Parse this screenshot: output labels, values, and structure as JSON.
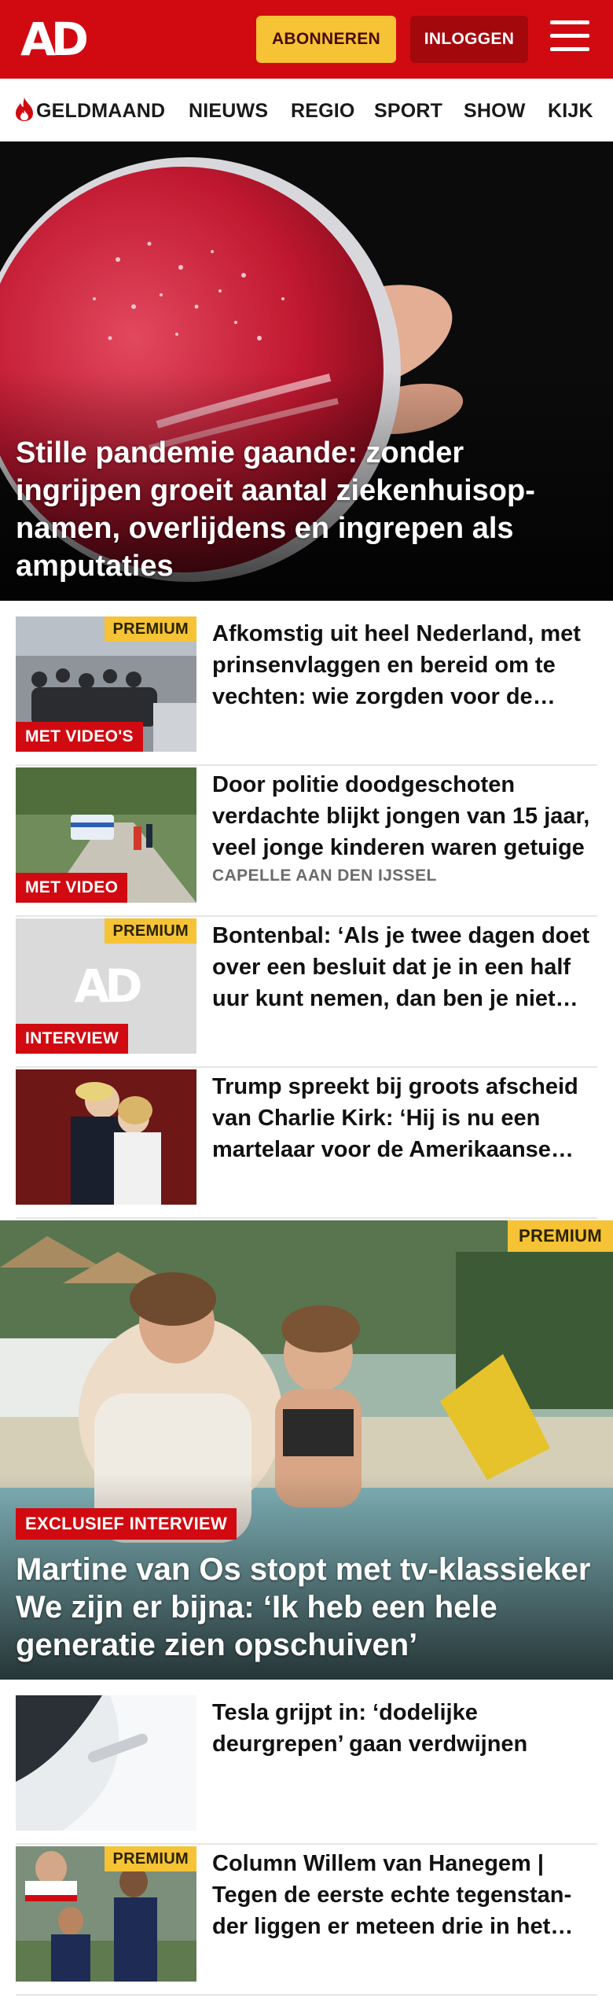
{
  "header": {
    "logo": "AD",
    "subscribe_label": "ABONNEREN",
    "login_label": "INLOGGEN"
  },
  "nav": {
    "items": [
      {
        "label": "GELDMAAND",
        "icon": "flame-icon"
      },
      {
        "label": "NIEUWS"
      },
      {
        "label": "REGIO"
      },
      {
        "label": "SPORT"
      },
      {
        "label": "SHOW"
      },
      {
        "label": "KIJK"
      }
    ]
  },
  "hero": {
    "title": "Stille pandemie gaande: zonder ingrijpen groeit aantal ziekenhuisop­namen, overlijdens en ingrepen als amputaties"
  },
  "articles": [
    {
      "title": "Afkomstig uit heel Nederland, met prinsenvlaggen en bereid om te vechten: wie zorgden voor de rellen?",
      "premium": "PREMIUM",
      "tag": "MET VIDEO'S"
    },
    {
      "title": "Door politie doodgeschoten verdachte blijkt jongen van 15 jaar, veel jonge kinderen waren getuige",
      "tag": "MET VIDEO",
      "meta": "CAPELLE AAN DEN IJSSEL"
    },
    {
      "title": "Bontenbal: ‘Als je twee dagen doet over een besluit dat je in een half uur kunt nemen, dan ben je niet bezig’",
      "premium": "PREMIUM",
      "tag": "INTERVIEW",
      "placeholder_logo": "AD"
    },
    {
      "title": "Trump spreekt bij groots afscheid van Charlie Kirk: ‘Hij is nu een martelaar voor de Amerikaanse vrijheid’"
    }
  ],
  "feature": {
    "premium": "PREMIUM",
    "tag": "EXCLUSIEF INTERVIEW",
    "title": "Martine van Os stopt met tv-klassieker We zijn er bijna: ‘Ik heb een hele generatie zien opschuiven’"
  },
  "articles2": [
    {
      "title": "Tesla grijpt in: ‘dodelijke deurgrepen’ gaan verdwijnen"
    },
    {
      "title": "Column Willem van Hanegem | Tegen de eerste echte tegenstan­der liggen er meteen drie in het gras",
      "premium": "PREMIUM"
    }
  ],
  "colors": {
    "brand_red": "#d10a11",
    "premium_yellow": "#f5c335",
    "login_dark_red": "#a3080d"
  }
}
